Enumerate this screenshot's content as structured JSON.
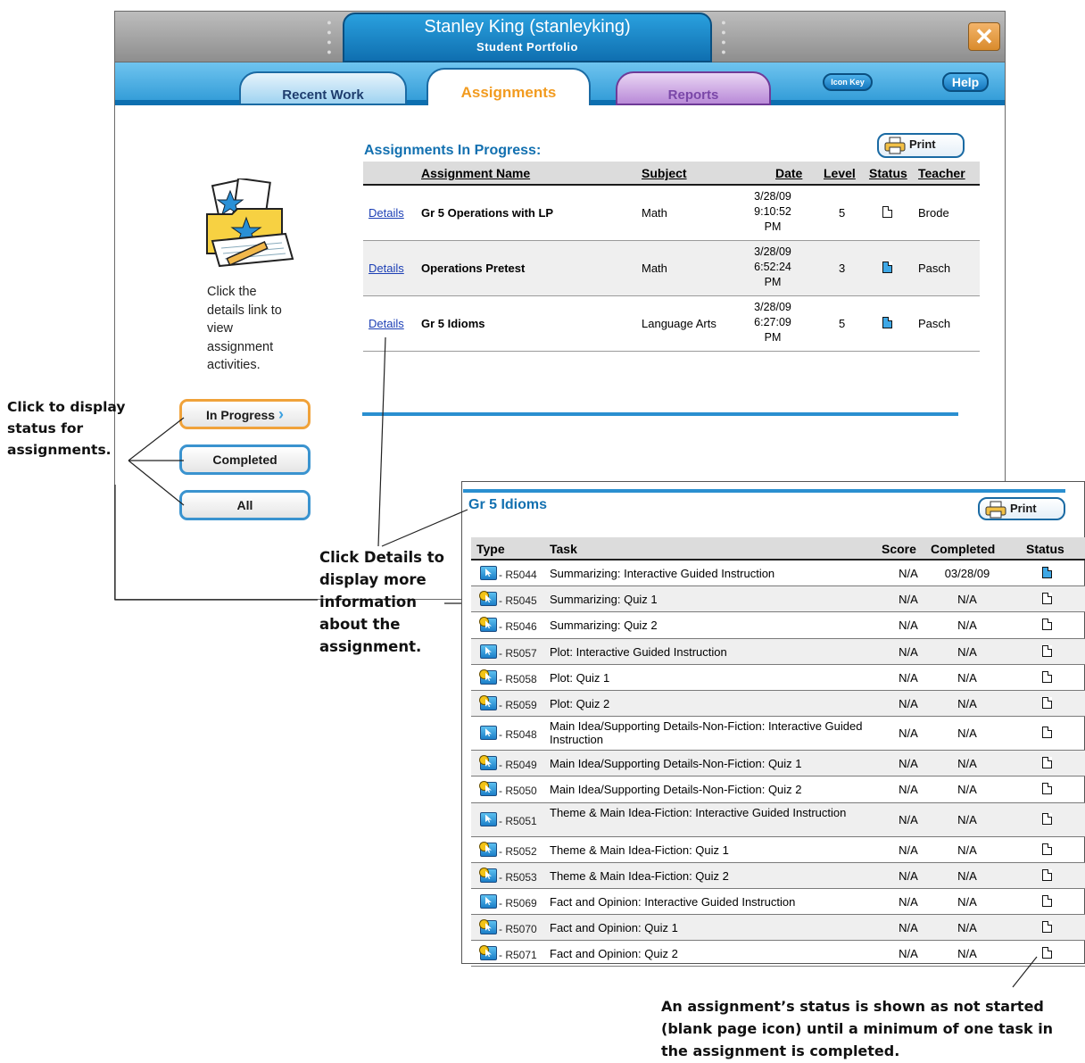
{
  "window": {
    "title": "Stanley King (stanleyking)",
    "subtitle": "Student Portfolio"
  },
  "tabs": [
    {
      "label": "Recent Work",
      "active": false
    },
    {
      "label": "Assignments",
      "active": true
    },
    {
      "label": "Reports",
      "active": false
    }
  ],
  "header_buttons": {
    "icon_key": "Icon Key",
    "help": "Help"
  },
  "sidebar": {
    "instructions": "Click the details link to view assignment activities.",
    "filters": [
      "In Progress",
      "Completed",
      "All"
    ],
    "active_filter": "In Progress"
  },
  "assignments": {
    "title": "Assignments In Progress:",
    "print_label": "Print",
    "columns": [
      "Assignment Name",
      "Subject",
      "Date",
      "Level",
      "Status",
      "Teacher"
    ],
    "rows": [
      {
        "link": "Details",
        "name": "Gr 5 Operations with LP",
        "subject": "Math",
        "date": [
          "3/28/09",
          "9:10:52",
          "PM"
        ],
        "level": "5",
        "status": "not-started",
        "teacher": "Brode"
      },
      {
        "link": "Details",
        "name": "Operations Pretest",
        "subject": "Math",
        "date": [
          "3/28/09",
          "6:52:24",
          "PM"
        ],
        "level": "3",
        "status": "started",
        "teacher": "Pasch"
      },
      {
        "link": "Details",
        "name": "Gr 5 Idioms",
        "subject": "Language Arts",
        "date": [
          "3/28/09",
          "6:27:09",
          "PM"
        ],
        "level": "5",
        "status": "started",
        "teacher": "Pasch"
      }
    ]
  },
  "detail": {
    "title": "Gr 5 Idioms",
    "print_label": "Print",
    "columns": [
      "Type",
      "Task",
      "Score",
      "Completed",
      "Status"
    ],
    "tasks": [
      {
        "type": "lesson",
        "code": "- R5044",
        "task": "Summarizing: Interactive Guided Instruction",
        "score": "N/A",
        "completed": "03/28/09",
        "status": "done"
      },
      {
        "type": "quiz",
        "code": "- R5045",
        "task": "Summarizing: Quiz 1",
        "score": "N/A",
        "completed": "N/A",
        "status": "not-started"
      },
      {
        "type": "quiz",
        "code": "- R5046",
        "task": "Summarizing: Quiz 2",
        "score": "N/A",
        "completed": "N/A",
        "status": "not-started"
      },
      {
        "type": "lesson",
        "code": "- R5057",
        "task": "Plot: Interactive Guided Instruction",
        "score": "N/A",
        "completed": "N/A",
        "status": "not-started"
      },
      {
        "type": "quiz",
        "code": "- R5058",
        "task": "Plot: Quiz 1",
        "score": "N/A",
        "completed": "N/A",
        "status": "not-started"
      },
      {
        "type": "quiz",
        "code": "- R5059",
        "task": "Plot: Quiz 2",
        "score": "N/A",
        "completed": "N/A",
        "status": "not-started"
      },
      {
        "type": "lesson",
        "code": "- R5048",
        "task": "Main Idea/Supporting Details-Non-Fiction: Interactive Guided Instruction",
        "score": "N/A",
        "completed": "N/A",
        "status": "not-started"
      },
      {
        "type": "quiz",
        "code": "- R5049",
        "task": "Main Idea/Supporting Details-Non-Fiction: Quiz 1",
        "score": "N/A",
        "completed": "N/A",
        "status": "not-started"
      },
      {
        "type": "quiz",
        "code": "- R5050",
        "task": "Main Idea/Supporting Details-Non-Fiction: Quiz 2",
        "score": "N/A",
        "completed": "N/A",
        "status": "not-started"
      },
      {
        "type": "lesson",
        "code": "- R5051",
        "task": "Theme & Main Idea-Fiction: Interactive Guided Instruction",
        "score": "N/A",
        "completed": "N/A",
        "status": "not-started"
      },
      {
        "type": "quiz",
        "code": "- R5052",
        "task": "Theme & Main Idea-Fiction: Quiz 1",
        "score": "N/A",
        "completed": "N/A",
        "status": "not-started"
      },
      {
        "type": "quiz",
        "code": "- R5053",
        "task": "Theme & Main Idea-Fiction: Quiz 2",
        "score": "N/A",
        "completed": "N/A",
        "status": "not-started"
      },
      {
        "type": "lesson",
        "code": "- R5069",
        "task": "Fact and Opinion: Interactive Guided Instruction",
        "score": "N/A",
        "completed": "N/A",
        "status": "not-started"
      },
      {
        "type": "quiz",
        "code": "- R5070",
        "task": "Fact and Opinion: Quiz 1",
        "score": "N/A",
        "completed": "N/A",
        "status": "not-started"
      },
      {
        "type": "quiz",
        "code": "- R5071",
        "task": "Fact and Opinion: Quiz 2",
        "score": "N/A",
        "completed": "N/A",
        "status": "not-started"
      }
    ]
  },
  "annotations": {
    "filters_note": "Click to display status for assignments.",
    "details_note": "Click Details to display more information about the assignment.",
    "status_note": "An assignment’s status is shown as not started (blank page icon) until a minimum of one task in the assignment is completed."
  }
}
